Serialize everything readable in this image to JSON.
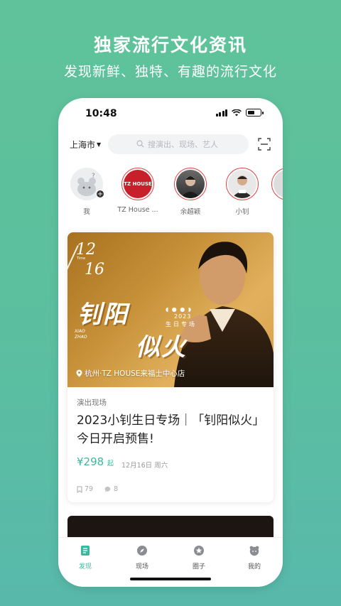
{
  "banner": {
    "headline": "独家流行文化资讯",
    "subline": "发现新鲜、独特、有趣的流行文化"
  },
  "status_bar": {
    "time": "10:48"
  },
  "top_bar": {
    "city": "上海市",
    "search_placeholder": "搜演出、现场、艺人"
  },
  "stories": [
    {
      "label": "我",
      "icon": "default-avatar-icon"
    },
    {
      "label": "TZ House ...",
      "logo_text": "TZ HOUSE"
    },
    {
      "label": "余超颖"
    },
    {
      "label": "小钊"
    }
  ],
  "feed_card": {
    "poster": {
      "date_month": "12",
      "date_day": "16",
      "date_tiny": "Time",
      "title_line1": "钊阳",
      "title_line2": "似火",
      "latin_line1": "XIAO",
      "latin_line2": "ZHAO",
      "year": "2023",
      "subtitle": "生日专场",
      "location": "杭州·TZ HOUSE来福士中心店"
    },
    "category": "演出现场",
    "title": "2023小钊生日专场｜「钊阳似火」 今日开启预售!",
    "price": "¥298",
    "price_unit": "起",
    "date": "12月16日 周六",
    "bookmarks": "79",
    "comments": "8"
  },
  "tabbar": {
    "items": [
      {
        "label": "发现",
        "icon": "discover-icon",
        "active": true
      },
      {
        "label": "现场",
        "icon": "compass-icon",
        "active": false
      },
      {
        "label": "圈子",
        "icon": "star-icon",
        "active": false
      },
      {
        "label": "我的",
        "icon": "profile-icon",
        "active": false
      }
    ]
  },
  "colors": {
    "accent": "#3cb8a0",
    "background": "#5fc29a",
    "story_ring": "#e04848"
  }
}
